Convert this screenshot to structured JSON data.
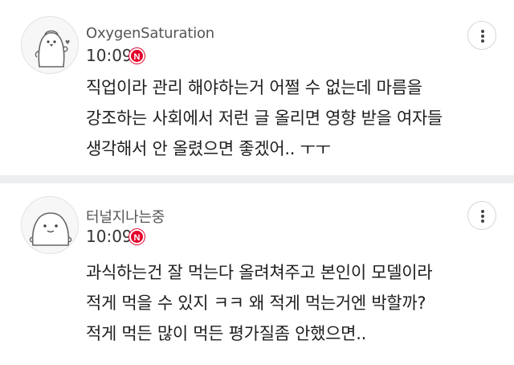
{
  "comments": [
    {
      "author": "OxygenSaturation",
      "time": "10:09",
      "badge": "N",
      "avatar_icon": "penguin-avatar-icon",
      "lines": [
        "직업이라 관리 해야하는거 어쩔 수 없는데 마름을",
        "강조하는 사회에서 저런 글 올리면 영향 받을 여자들",
        "생각해서 안 올렸으면 좋겠어.. ㅜㅜ"
      ]
    },
    {
      "author": "터널지나는중",
      "time": "10:09",
      "badge": "N",
      "avatar_icon": "blob-avatar-icon",
      "lines": [
        "과식하는건 잘 먹는다 올려쳐주고 본인이 모델이라",
        "적게 먹을 수 있지 ㅋㅋ 왜 적게 먹는거엔 박할까?",
        "적게 먹든 많이 먹든 평가질좀 안했으면.."
      ]
    }
  ],
  "more_icon": "more-vertical-icon",
  "colors": {
    "badge": "#e4002b",
    "separator": "#eceef0"
  }
}
